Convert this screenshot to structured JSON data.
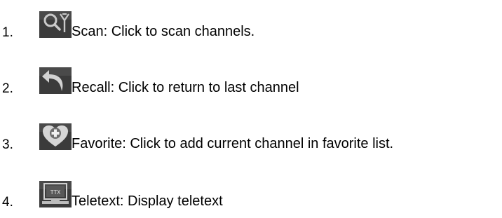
{
  "items": [
    {
      "number": "1.",
      "label": "Scan: Click to scan channels.",
      "icon": "scan-antenna-magnifier-icon"
    },
    {
      "number": "2.",
      "label": "Recall: Click to return to last channel",
      "icon": "recall-return-arrow-icon"
    },
    {
      "number": "3.",
      "label": "Favorite: Click to add current channel in favorite list.",
      "icon": "favorite-heart-plus-icon"
    },
    {
      "number": "4.",
      "label": "Teletext: Display teletext",
      "icon": "teletext-ttx-monitor-icon"
    }
  ],
  "colors": {
    "icon_background": "#3a3a3a",
    "icon_glyph": "#c8c8c8",
    "heart": "#d7d7d7",
    "plus": "#f2f2f2",
    "text": "#000000",
    "page_background": "#ffffff"
  }
}
